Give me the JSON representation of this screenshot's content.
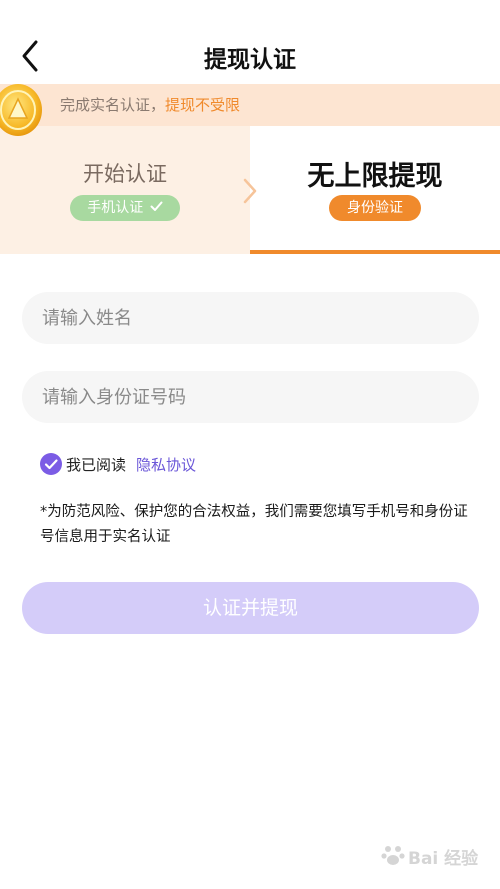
{
  "nav": {
    "title": "提现认证"
  },
  "banner": {
    "text": "完成实名认证，",
    "highlight": "提现不受限"
  },
  "steps": {
    "step1": {
      "title": "开始认证",
      "badge": "手机认证"
    },
    "step2": {
      "title": "无上限提现",
      "badge": "身份验证"
    }
  },
  "form": {
    "name_placeholder": "请输入姓名",
    "id_placeholder": "请输入身份证号码",
    "agree_prefix": "我已阅读",
    "agree_link": "隐私协议",
    "notice": "*为防范风险、保护您的合法权益，我们需要您填写手机号和身份证号信息用于实名认证",
    "submit": "认证并提现"
  },
  "colors": {
    "accent_orange": "#f08a2c",
    "accent_purple": "#7b5ce5",
    "button_disabled": "#d4ccf9",
    "badge_green": "#a8d9a0"
  },
  "icons": [
    "back-arrow-icon",
    "coin-icon",
    "chevron-right-icon",
    "check-icon",
    "checkbox-checked-icon"
  ],
  "watermark": {
    "text": "Bai 经验"
  }
}
